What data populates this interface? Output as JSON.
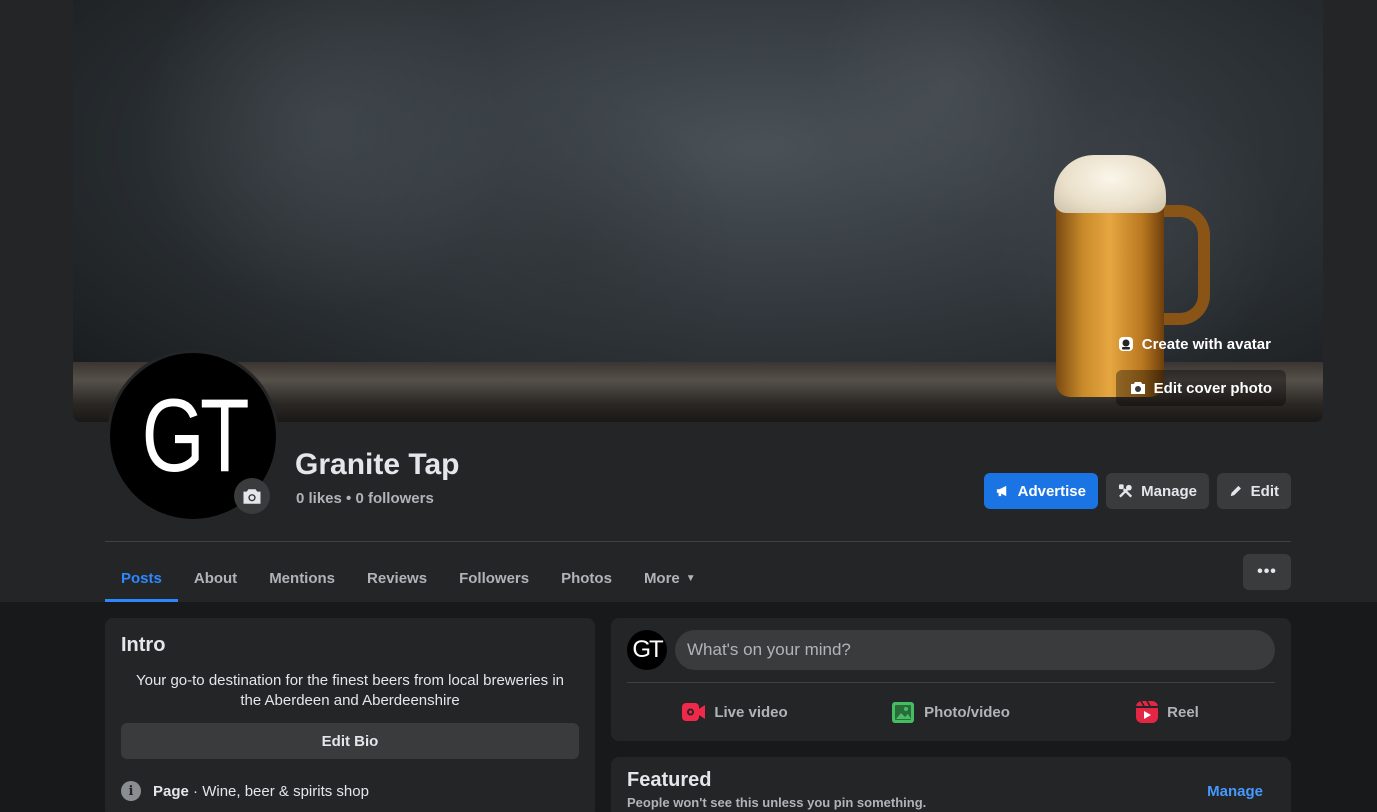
{
  "cover": {
    "create_avatar_label": "Create with avatar",
    "edit_cover_label": "Edit cover photo"
  },
  "profile": {
    "monogram": "GT",
    "name": "Granite Tap",
    "stats": "0 likes • 0 followers"
  },
  "actions": {
    "advertise": "Advertise",
    "manage": "Manage",
    "edit": "Edit"
  },
  "tabs": [
    {
      "label": "Posts",
      "active": true
    },
    {
      "label": "About"
    },
    {
      "label": "Mentions"
    },
    {
      "label": "Reviews"
    },
    {
      "label": "Followers"
    },
    {
      "label": "Photos"
    },
    {
      "label": "More"
    }
  ],
  "more_menu_label": "•••",
  "intro": {
    "title": "Intro",
    "bio": "Your go-to destination for the finest beers from local breweries in the Aberdeen and Aberdeenshire",
    "edit_bio": "Edit Bio",
    "page_label": "Page",
    "separator": " · ",
    "category": "Wine, beer & spirits shop"
  },
  "composer": {
    "avatar_monogram": "GT",
    "placeholder": "What's on your mind?",
    "live_video": "Live video",
    "photo_video": "Photo/video",
    "reel": "Reel"
  },
  "featured": {
    "title": "Featured",
    "subtitle": "People won't see this unless you pin something.",
    "manage": "Manage"
  },
  "colors": {
    "accent": "#2d88ff",
    "button_primary": "#1b74e4",
    "live_video_icon": "#f02849",
    "photo_icon": "#45bd62",
    "reel_icon": "#e42645"
  }
}
